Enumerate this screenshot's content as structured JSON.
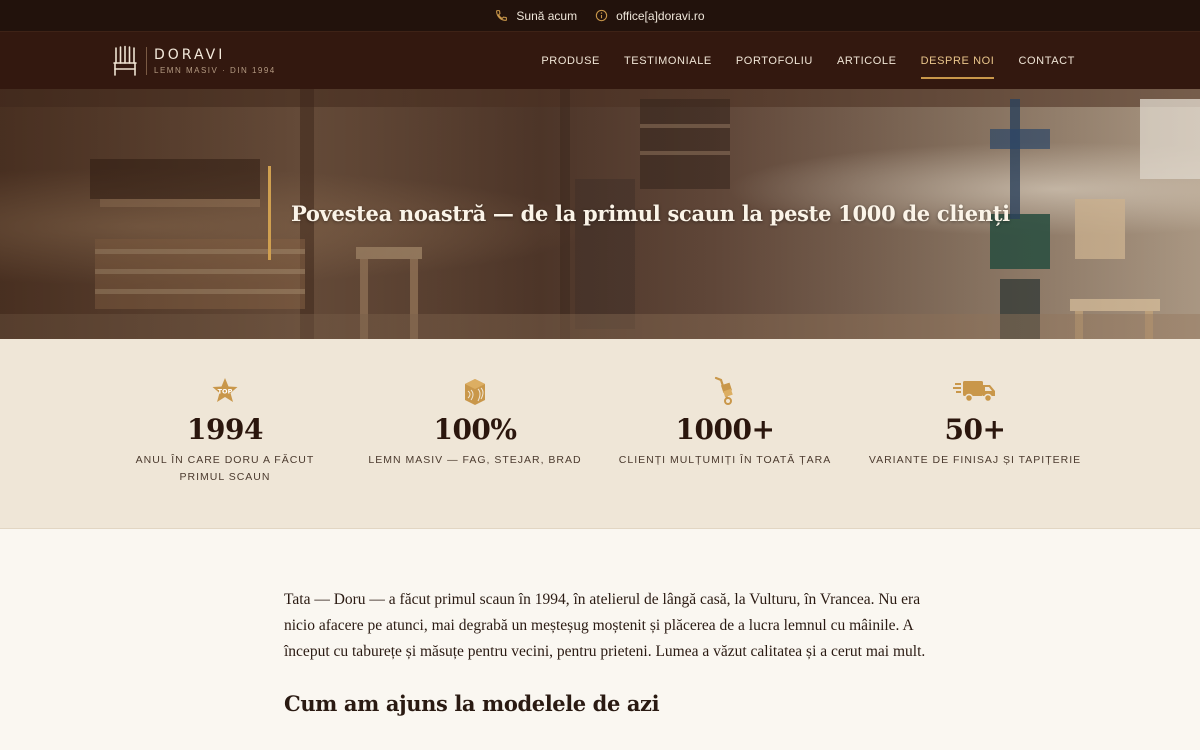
{
  "topbar": {
    "phone_label": "Sună acum",
    "email_label": "office[a]doravi.ro"
  },
  "brand": {
    "name": "DORAVI",
    "tagline": "LEMN MASIV · DIN 1994"
  },
  "nav": {
    "items": [
      {
        "label": "PRODUSE"
      },
      {
        "label": "TESTIMONIALE"
      },
      {
        "label": "PORTOFOLIU"
      },
      {
        "label": "ARTICOLE"
      },
      {
        "label": "DESPRE NOI",
        "active": true
      },
      {
        "label": "CONTACT"
      }
    ]
  },
  "hero": {
    "title": "Povestea noastră — de la primul scaun la peste 1000 de clienți"
  },
  "stats": [
    {
      "icon": "top-badge-icon",
      "value": "1994",
      "label": "ANUL ÎN CARE DORU A FĂCUT PRIMUL SCAUN"
    },
    {
      "icon": "wood-block-icon",
      "value": "100%",
      "label": "LEMN MASIV — FAG, STEJAR, BRAD"
    },
    {
      "icon": "hand-truck-icon",
      "value": "1000+",
      "label": "CLIENȚI MULȚUMIȚI ÎN TOATĂ ȚARA"
    },
    {
      "icon": "delivery-truck-icon",
      "value": "50+",
      "label": "VARIANTE DE FINISAJ ȘI TAPIȚERIE"
    }
  ],
  "content": {
    "intro": "Tata — Doru — a făcut primul scaun în 1994, în atelierul de lângă casă, la Vulturu, în Vrancea. Nu era nicio afacere pe atunci, mai degrabă un meșteșug moștenit și plăcerea de a lucra lemnul cu mâinile. A început cu taburețe și măsuțe pentru vecini, pentru prieteni. Lumea a văzut calitatea și a cerut mai mult.",
    "heading": "Cum am ajuns la modelele de azi"
  },
  "colors": {
    "accent": "#c9974a",
    "topbar_bg": "#22120c",
    "header_bg": "#33180f",
    "stats_bg": "#efe6d7",
    "page_bg": "#faf7f1"
  }
}
